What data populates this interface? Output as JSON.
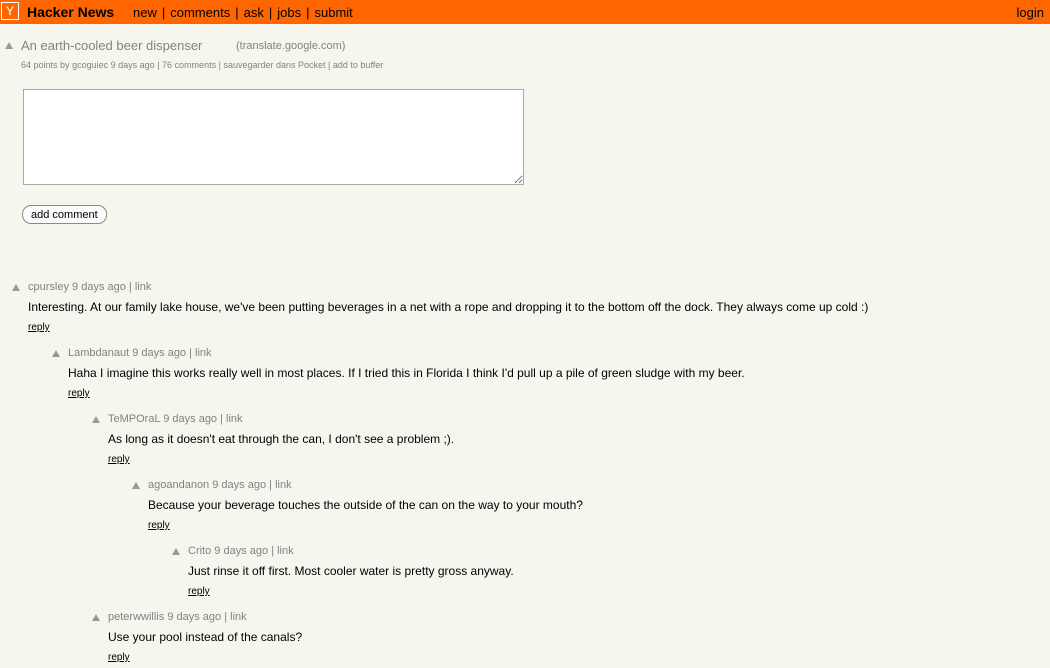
{
  "header": {
    "logo": "Y",
    "site_name": "Hacker News",
    "nav": [
      "new",
      "comments",
      "ask",
      "jobs",
      "submit"
    ],
    "separator": "|",
    "login": "login",
    "bar_color": "#ff6600"
  },
  "story": {
    "title": "An earth-cooled beer dispenser",
    "domain": "(translate.google.com)",
    "points": "64 points",
    "by": "by",
    "user": "gcoguiec",
    "age": "9 days ago",
    "comments": "76 comments",
    "pocket": "sauvegarder dans Pocket",
    "buffer": "add to buffer",
    "sep": "|"
  },
  "form": {
    "comment_value": "",
    "submit_label": "add comment"
  },
  "comments": [
    {
      "user": "cpursley",
      "age": "9 days ago",
      "link": "link",
      "text": "Interesting. At our family lake house, we've been putting beverages in a net with a rope and dropping it to the bottom off the dock. They always come up cold :)",
      "reply": "reply"
    },
    {
      "user": "Lambdanaut",
      "age": "9 days ago",
      "link": "link",
      "text": "Haha I imagine this works really well in most places. If I tried this in Florida I think I'd pull up a pile of green sludge with my beer.",
      "reply": "reply"
    },
    {
      "user": "TeMPOraL",
      "age": "9 days ago",
      "link": "link",
      "text": "As long as it doesn't eat through the can, I don't see a problem ;).",
      "reply": "reply"
    },
    {
      "user": "agoandanon",
      "age": "9 days ago",
      "link": "link",
      "text": "Because your beverage touches the outside of the can on the way to your mouth?",
      "reply": "reply"
    },
    {
      "user": "Crito",
      "age": "9 days ago",
      "link": "link",
      "text": "Just rinse it off first. Most cooler water is pretty gross anyway.",
      "reply": "reply"
    },
    {
      "user": "peterwwillis",
      "age": "9 days ago",
      "link": "link",
      "text": "Use your pool instead of the canals?",
      "reply": "reply"
    }
  ]
}
